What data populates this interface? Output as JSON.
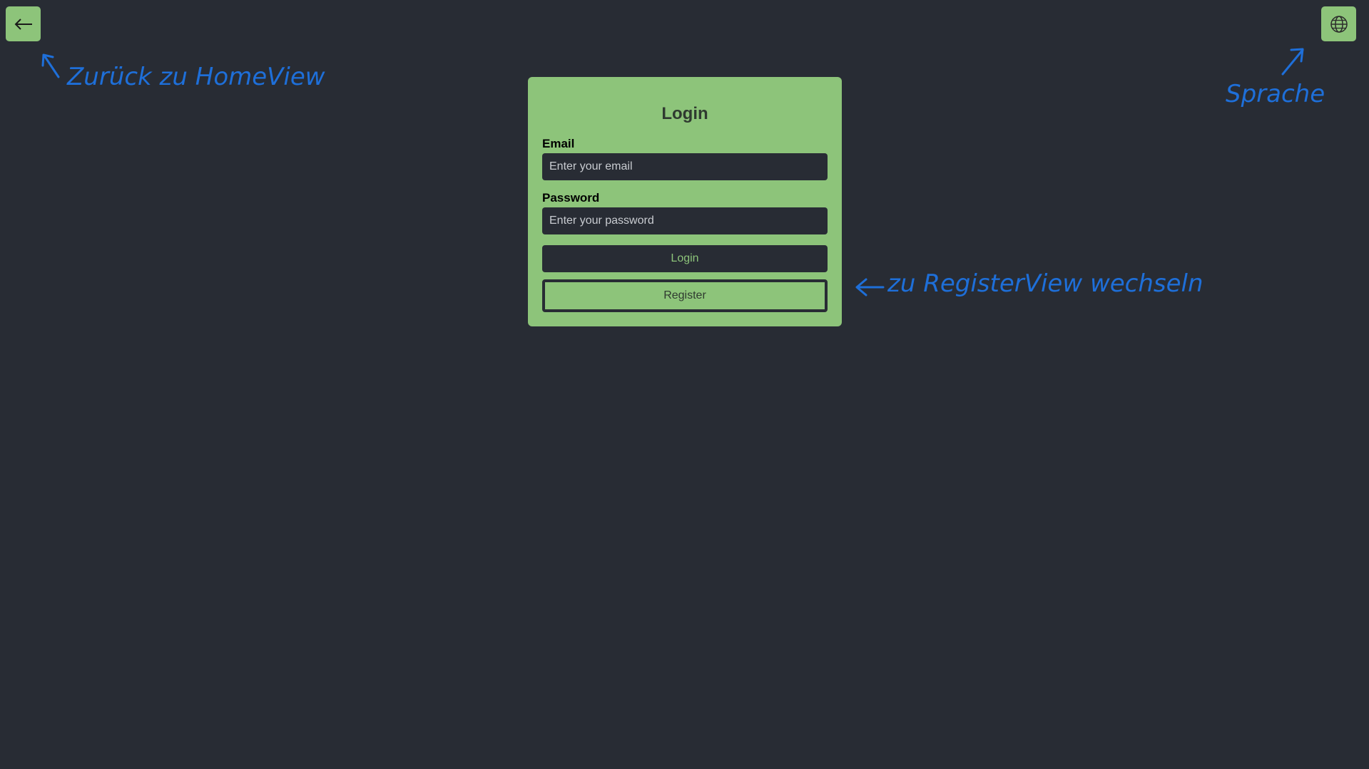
{
  "nav": {
    "back_icon": "arrow-left-icon",
    "language_icon": "globe-icon"
  },
  "login_card": {
    "title": "Login",
    "email_label": "Email",
    "email_placeholder": "Enter your email",
    "email_value": "",
    "password_label": "Password",
    "password_placeholder": "Enter your password",
    "password_value": "",
    "login_button": "Login",
    "register_button": "Register"
  },
  "annotations": {
    "back": "Zurück zu HomeView",
    "language": "Sprache",
    "register": "zu RegisterView wechseln"
  },
  "colors": {
    "background": "#282c34",
    "accent_green": "#8dc47a",
    "annotation_blue": "#1e6fd9"
  }
}
